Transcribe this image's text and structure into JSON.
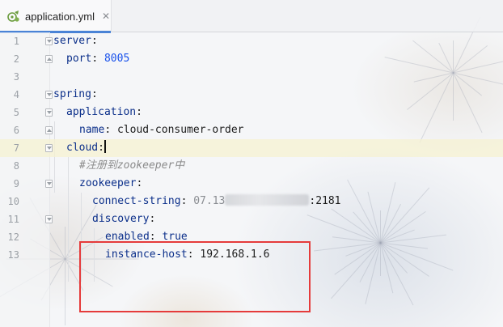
{
  "tab": {
    "file_name": "application.yml",
    "close_glyph": "✕",
    "icon": "yaml-file-icon"
  },
  "lines": [
    {
      "num": "1",
      "key": "server",
      "sep": ":",
      "value": ""
    },
    {
      "num": "2",
      "key": "port",
      "sep": ": ",
      "value": "8005"
    },
    {
      "num": "3",
      "key": "",
      "sep": "",
      "value": ""
    },
    {
      "num": "4",
      "key": "spring",
      "sep": ":",
      "value": ""
    },
    {
      "num": "5",
      "key": "application",
      "sep": ":",
      "value": ""
    },
    {
      "num": "6",
      "key": "name",
      "sep": ": ",
      "value": "cloud-consumer-order"
    },
    {
      "num": "7",
      "key": "cloud",
      "sep": ":",
      "value": ""
    },
    {
      "num": "8",
      "comment": "#注册到zookeeper中"
    },
    {
      "num": "9",
      "key": "zookeeper",
      "sep": ":",
      "value": ""
    },
    {
      "num": "10",
      "key": "connect-string",
      "sep": ": ",
      "value_visible_prefix": "07.13",
      "value_suffix": ":2181"
    },
    {
      "num": "11",
      "key": "discovery",
      "sep": ":",
      "value": ""
    },
    {
      "num": "12",
      "key": "enabled",
      "sep": ": ",
      "value": "true"
    },
    {
      "num": "13",
      "key": "instance-host",
      "sep": ": ",
      "value": "192.168.1.6"
    }
  ],
  "colors": {
    "key": "#0b2f8a",
    "number": "#1750eb",
    "comment": "#8c8c8c",
    "highlight_box": "#e53b3b",
    "current_line": "#f6f2d2"
  }
}
